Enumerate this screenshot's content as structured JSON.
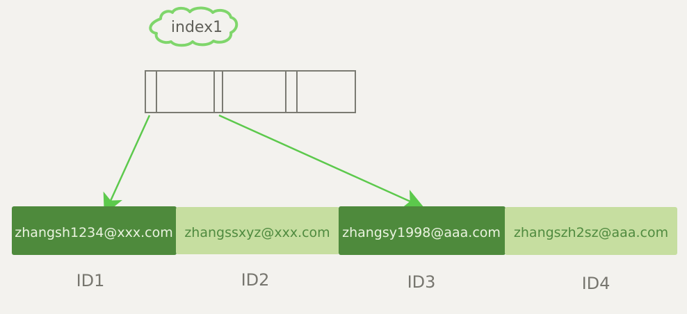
{
  "index_label": "index1",
  "records": [
    {
      "email": "zhangsh1234@xxx.com",
      "id": "ID1",
      "highlighted": true
    },
    {
      "email": "zhangssxyz@xxx.com",
      "id": "ID2",
      "highlighted": false
    },
    {
      "email": "zhangsy1998@aaa.com",
      "id": "ID3",
      "highlighted": true
    },
    {
      "email": "zhangszh2sz@aaa.com",
      "id": "ID4",
      "highlighted": false
    }
  ],
  "colors": {
    "background": "#f3f2ee",
    "highlight_fill": "#4e8a3c",
    "normal_fill": "#c6dea0",
    "highlight_text": "#eaf3df",
    "normal_text": "#4f8a3f",
    "arrow": "#5cc94c",
    "cloud_stroke": "#7fd66b",
    "index_stroke": "#7a7a72",
    "id_text": "#77766f"
  }
}
